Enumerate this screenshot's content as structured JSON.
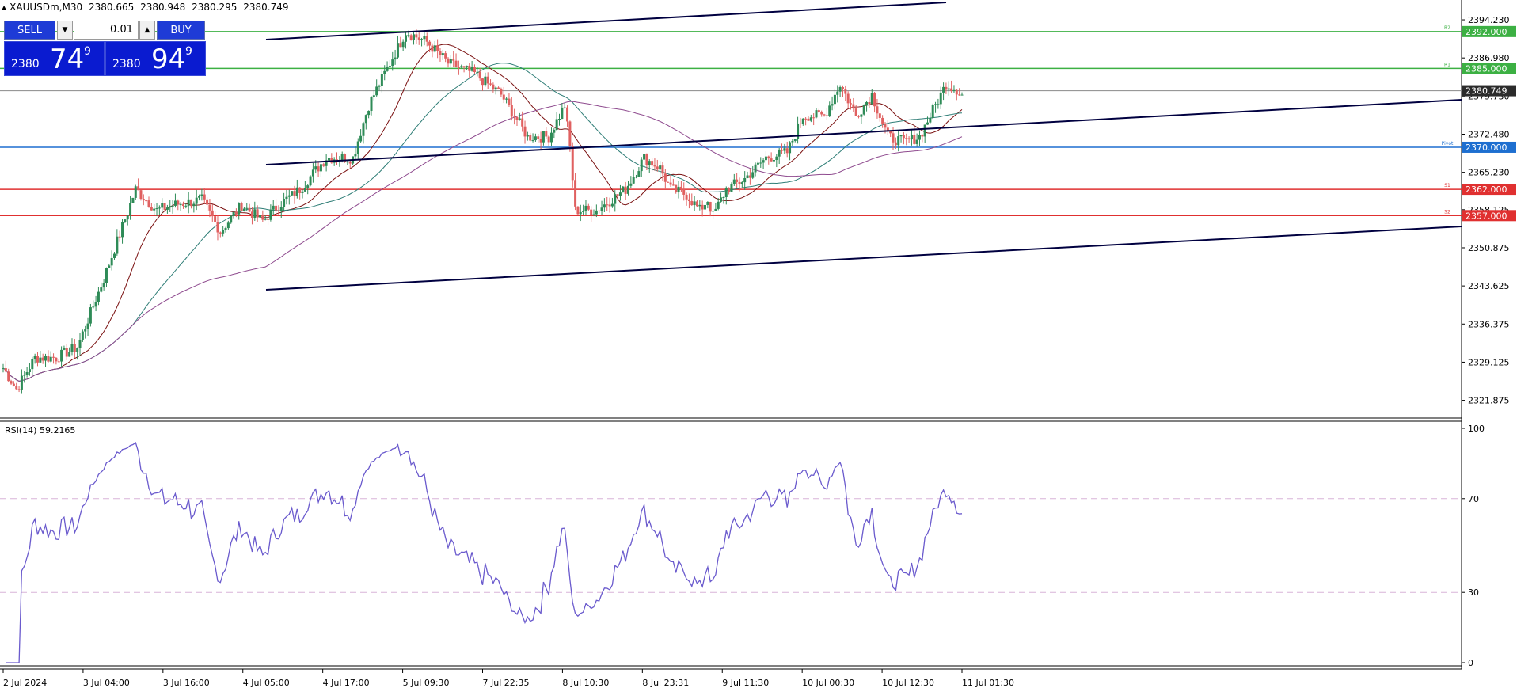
{
  "header": {
    "symbol": "XAUUSDm,M30",
    "open": "2380.665",
    "high": "2380.948",
    "low": "2380.295",
    "close": "2380.749"
  },
  "trade_panel": {
    "sell_label": "SELL",
    "buy_label": "BUY",
    "lot": "0.01",
    "sell_prefix": "2380",
    "sell_big": "74",
    "sell_sup": "9",
    "buy_prefix": "2380",
    "buy_big": "94",
    "buy_sup": "9"
  },
  "price_axis": {
    "ticks": [
      "2394.230",
      "2386.980",
      "2379.730",
      "2372.480",
      "2365.230",
      "2358.125",
      "2350.875",
      "2343.625",
      "2336.375",
      "2329.125",
      "2321.875"
    ]
  },
  "levels": [
    {
      "label": "2392.000",
      "price": 2392.0,
      "color": "#3cb043",
      "tag": "R2"
    },
    {
      "label": "2385.000",
      "price": 2385.0,
      "color": "#3cb043",
      "tag": "R1"
    },
    {
      "label": "2370.000",
      "price": 2370.0,
      "color": "#1e6fd0",
      "tag": "Pivot"
    },
    {
      "label": "2362.000",
      "price": 2362.0,
      "color": "#e03030",
      "tag": "S1"
    },
    {
      "label": "2357.000",
      "price": 2357.0,
      "color": "#e03030",
      "tag": "S2"
    }
  ],
  "current_price": {
    "label": "2380.749",
    "price": 2380.749
  },
  "time_axis": {
    "labels": [
      "2 Jul 2024",
      "3 Jul 04:00",
      "3 Jul 16:00",
      "4 Jul 05:00",
      "4 Jul 17:00",
      "5 Jul 09:30",
      "7 Jul 22:35",
      "8 Jul 10:30",
      "8 Jul 23:31",
      "9 Jul 11:30",
      "10 Jul 00:30",
      "10 Jul 12:30",
      "11 Jul 01:30"
    ]
  },
  "rsi": {
    "label": "RSI(14) 59.2165",
    "levels": [
      "100",
      "70",
      "30",
      "0"
    ],
    "upper_level": 70,
    "lower_level": 30
  },
  "colors": {
    "bull": "#2e8b57",
    "bear": "#e06060",
    "ma_fast": "#7a1010",
    "ma_mid": "#2e7d76",
    "ma_slow": "#8e4a8e",
    "rsi_line": "#6a5acd",
    "trendline": "#000040"
  },
  "chart_data": {
    "type": "candlestick",
    "price_range": [
      2318.5,
      2398.0
    ],
    "keypoints": [
      [
        0,
        2328
      ],
      [
        5,
        2324
      ],
      [
        12,
        2330
      ],
      [
        20,
        2330
      ],
      [
        28,
        2332
      ],
      [
        38,
        2345
      ],
      [
        50,
        2362
      ],
      [
        58,
        2358
      ],
      [
        64,
        2359
      ],
      [
        75,
        2360
      ],
      [
        82,
        2354
      ],
      [
        90,
        2359
      ],
      [
        98,
        2356
      ],
      [
        104,
        2359
      ],
      [
        112,
        2362
      ],
      [
        122,
        2368
      ],
      [
        132,
        2368
      ],
      [
        138,
        2378
      ],
      [
        146,
        2386
      ],
      [
        152,
        2392
      ],
      [
        160,
        2390
      ],
      [
        168,
        2386
      ],
      [
        178,
        2384
      ],
      [
        188,
        2380
      ],
      [
        198,
        2372
      ],
      [
        206,
        2372
      ],
      [
        212,
        2378
      ],
      [
        214,
        2370
      ],
      [
        216,
        2358
      ],
      [
        224,
        2358
      ],
      [
        235,
        2362
      ],
      [
        242,
        2368
      ],
      [
        248,
        2366
      ],
      [
        252,
        2362
      ],
      [
        258,
        2361
      ],
      [
        263,
        2358
      ],
      [
        266,
        2360
      ],
      [
        268,
        2357
      ],
      [
        273,
        2362
      ],
      [
        280,
        2364
      ],
      [
        288,
        2368
      ],
      [
        296,
        2369
      ],
      [
        302,
        2376
      ],
      [
        310,
        2376
      ],
      [
        316,
        2382
      ],
      [
        322,
        2376
      ],
      [
        328,
        2380
      ],
      [
        334,
        2372
      ],
      [
        340,
        2371
      ],
      [
        346,
        2372
      ],
      [
        350,
        2376
      ],
      [
        356,
        2382
      ],
      [
        360,
        2381
      ],
      [
        362,
        2380
      ]
    ]
  }
}
